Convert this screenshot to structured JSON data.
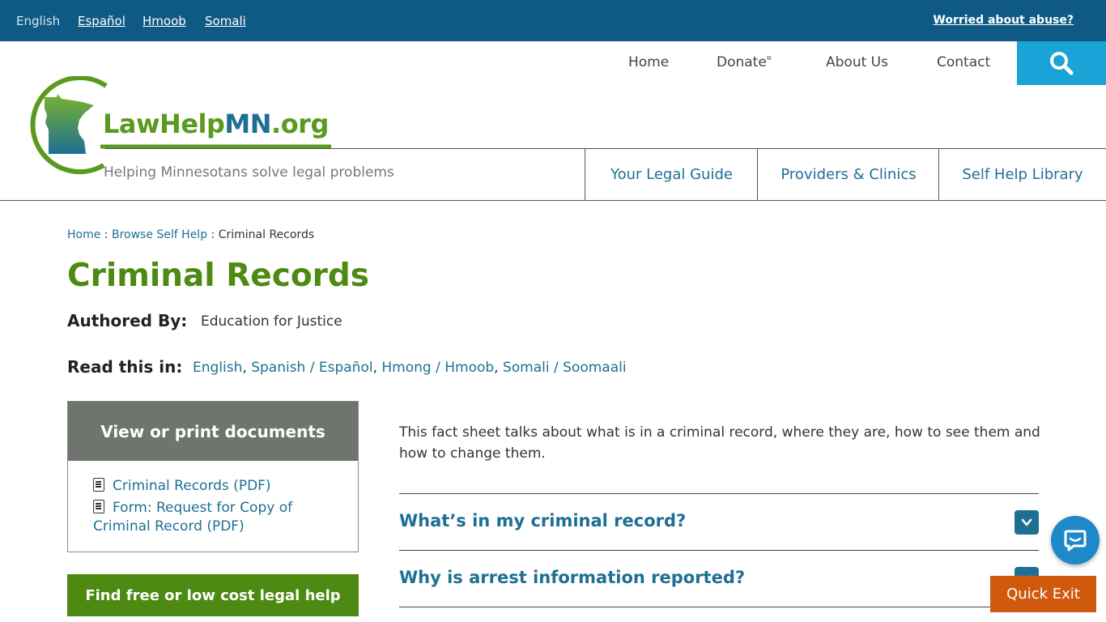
{
  "topbar": {
    "languages": [
      {
        "label": "English",
        "current": true
      },
      {
        "label": "Español",
        "current": false
      },
      {
        "label": "Hmoob",
        "current": false
      },
      {
        "label": "Somali",
        "current": false
      }
    ],
    "worried": "Worried about abuse?"
  },
  "nav": {
    "items": [
      "Home",
      "Donate",
      "About Us",
      "Contact"
    ],
    "search_icon": "search-icon"
  },
  "logo": {
    "text_part1": "LawHelp",
    "text_part2": "MN",
    "text_part3": ".org",
    "tagline": "Helping Minnesotans solve legal problems"
  },
  "subnav": {
    "items": [
      "Your Legal Guide",
      "Providers & Clinics",
      "Self Help Library"
    ]
  },
  "breadcrumb": {
    "items": [
      "Home",
      "Browse Self Help",
      "Criminal Records"
    ],
    "separator": " : "
  },
  "page": {
    "title": "Criminal Records",
    "authored_label": "Authored By:",
    "authored_value": "Education for Justice",
    "read_label": "Read this in:",
    "read_links": [
      "English",
      "Spanish / Español",
      "Hmong / Hmoob",
      "Somali / Soomaali"
    ]
  },
  "documents": {
    "heading": "View or print documents",
    "items": [
      "Criminal Records (PDF)",
      "Form: Request for Copy of Criminal Record (PDF)"
    ]
  },
  "find_help": "Find free or low cost legal help",
  "content": {
    "intro": "This fact sheet talks about what is in a criminal record, where they are, how to see them and how to change them.",
    "accordion": [
      "What’s in my criminal record?",
      "Why is arrest information reported?"
    ]
  },
  "quick_exit": "Quick Exit",
  "colors": {
    "topbar": "#0e5a84",
    "search": "#1aa3d6",
    "green": "#4d8a12",
    "link": "#1e6f94",
    "quick_exit": "#cf5a0d"
  }
}
